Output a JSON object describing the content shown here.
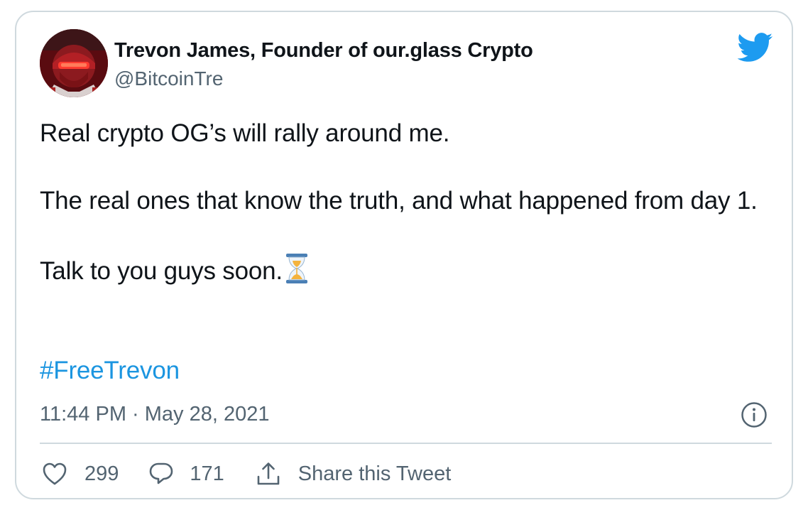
{
  "tweet": {
    "author": {
      "display_name": "Trevon James, Founder of our.glass Crypto",
      "handle": "@BitcoinTre"
    },
    "paragraphs": [
      "Real crypto OG’s will rally around me.",
      "The real ones that know the truth, and what happened from day 1.",
      "Talk to you guys soon."
    ],
    "emoji": "hourglass-icon",
    "hashtag": "#FreeTrevon",
    "timestamp": "11:44 PM · May 28, 2021",
    "likes": "299",
    "replies": "171",
    "share_label": "Share this Tweet"
  },
  "icons": {
    "brand": "twitter-bird-icon",
    "info": "info-icon",
    "like": "heart-icon",
    "reply": "speech-bubble-icon",
    "share": "share-icon"
  },
  "colors": {
    "text": "#0f1419",
    "secondary": "#536471",
    "link": "#1b95e0",
    "twitter_blue": "#1d9bf0",
    "border": "#cfd9de"
  }
}
